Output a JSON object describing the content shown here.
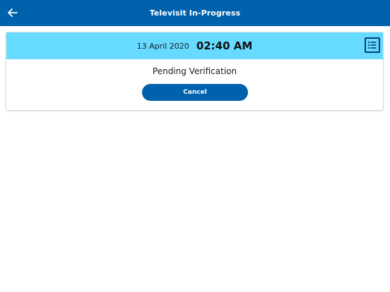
{
  "header": {
    "title": "Televisit In-Progress",
    "back_icon": "arrow-left-icon"
  },
  "visit_card": {
    "date": "13 April 2020",
    "time": "02:40 AM",
    "list_icon": "list-icon",
    "status": "Pending Verification",
    "cancel_label": "Cancel"
  },
  "colors": {
    "primary": "#0061ad",
    "header_band": "#66daff",
    "icon_dark": "#0b3a73",
    "text_dark": "#1a1a1a",
    "background": "#ffffff"
  }
}
